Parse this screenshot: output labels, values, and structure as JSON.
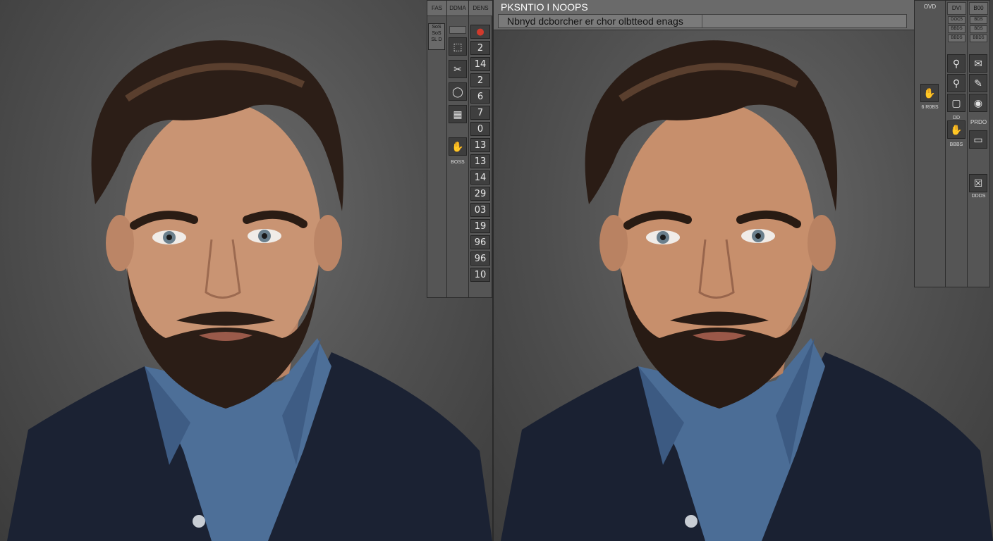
{
  "topbar": {
    "title": "PKSNTIO I NOOPS",
    "field_text": "Nbnyd dcborcher er chor olbtteod enags"
  },
  "left_palette": {
    "headers": [
      "FAS",
      "DDMA",
      "DENS"
    ],
    "col1_text": "SoS SoS SL D",
    "col1_label": "BOSS",
    "col2_label": "BOSS",
    "col3_top_icon": "red-tool-icon",
    "numbers": [
      "2",
      "14",
      "2",
      "6",
      "7",
      "0",
      "13",
      "13",
      "14",
      "29",
      "03",
      "19",
      "96",
      "96",
      "10"
    ]
  },
  "right_palette": {
    "tabs": [
      "DVI",
      "B00"
    ],
    "side_label": "OVD",
    "chips_col2": [
      "DOC5",
      "BBDS",
      "BBDS"
    ],
    "chips_col3": [
      "BDS",
      "BDS",
      "BBDS"
    ],
    "side_small_label": "6 R0BS",
    "col2_labels": [
      "DD",
      "BBBS"
    ],
    "col3_labels": [
      "PRDO",
      "DDDS"
    ]
  },
  "icons": {
    "left_col2": [
      "frame-icon",
      "crop-icon",
      "circle-icon",
      "layers-icon",
      "hand-icon"
    ],
    "right_col2": [
      "magnify-icon",
      "search-icon",
      "frame-icon",
      "hand-icon"
    ],
    "right_col3": [
      "chat-icon",
      "brush-icon",
      "globe-icon",
      "monitor-icon",
      "close-box-icon"
    ],
    "right_col1": "hand-icon"
  },
  "colors": {
    "background": "#4f4f4f",
    "panel": "#555555",
    "jacket": "#1b2233",
    "shirt": "#4d6f98"
  }
}
